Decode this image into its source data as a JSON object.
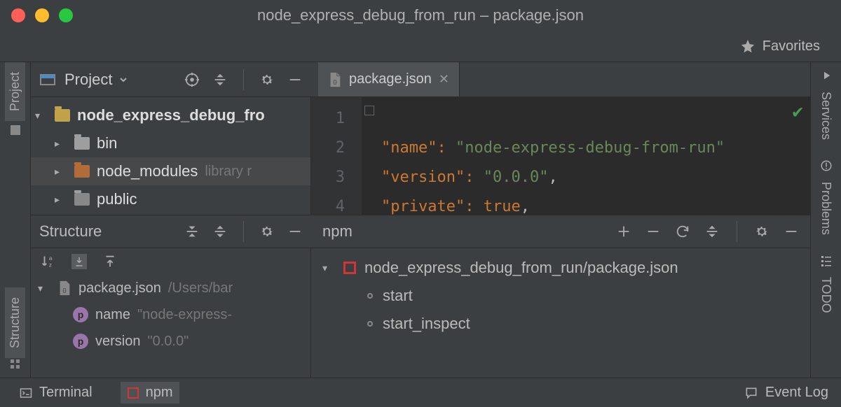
{
  "window": {
    "title": "node_express_debug_from_run – package.json"
  },
  "toolbar": {
    "favorites": "Favorites"
  },
  "left_stripe": {
    "project": "Project",
    "structure": "Structure"
  },
  "right_stripe": {
    "services": "Services",
    "problems": "Problems",
    "todo": "TODO"
  },
  "project_panel": {
    "title": "Project",
    "tree": {
      "root": "node_express_debug_fro",
      "items": [
        {
          "label": "bin"
        },
        {
          "label": "node_modules",
          "suffix": "library r"
        },
        {
          "label": "public"
        }
      ]
    }
  },
  "editor": {
    "tab": "package.json",
    "lines": [
      "1",
      "2",
      "3",
      "4"
    ],
    "code": {
      "name_key": "\"name\"",
      "name_val": "\"node-express-debug-from-run\"",
      "version_key": "\"version\"",
      "version_val": "\"0.0.0\"",
      "private_key": "\"private\"",
      "private_val": "true"
    }
  },
  "structure_panel": {
    "title": "Structure",
    "file": "package.json",
    "file_path": "/Users/bar",
    "props": [
      {
        "name": "name",
        "value": "\"node-express-"
      },
      {
        "name": "version",
        "value": "\"0.0.0\""
      }
    ]
  },
  "npm_panel": {
    "title": "npm",
    "tree_label": "node_express_debug_from_run/package.json",
    "scripts": [
      "start",
      "start_inspect"
    ]
  },
  "bottom_bar": {
    "terminal": "Terminal",
    "npm": "npm",
    "event_log": "Event Log"
  }
}
